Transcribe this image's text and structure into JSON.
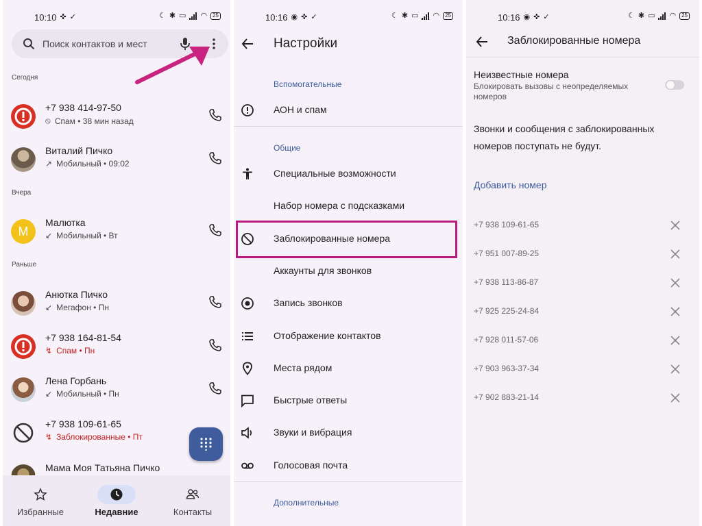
{
  "p1": {
    "time": "10:10",
    "battery": "25",
    "search_placeholder": "Поиск контактов и мест",
    "sections": {
      "today": "Сегодня",
      "yesterday": "Вчера",
      "earlier": "Раньше"
    },
    "calls": [
      {
        "name": "+7 938 414-97-50",
        "meta": "Спам • 38 мин назад",
        "type": "spam"
      },
      {
        "name": "Виталий Пичко",
        "meta": "Мобильный • 09:02",
        "type": "outgoing"
      },
      {
        "name": "Малютка",
        "meta": "Мобильный • Вт",
        "type": "incoming",
        "initial": "М"
      },
      {
        "name": "Анютка Пичко",
        "meta": "Мегафон • Пн",
        "type": "incoming"
      },
      {
        "name": "+7 938 164-81-54",
        "meta": "Спам • Пн",
        "type": "missed-spam"
      },
      {
        "name": "Лена Горбань",
        "meta": "Мобильный • Пн",
        "type": "incoming"
      },
      {
        "name": "+7 938 109-61-65",
        "meta": "Заблокированные • Пт",
        "type": "blocked"
      },
      {
        "name": "Мама Моя Татьяна Пичко",
        "meta": "",
        "type": "incoming"
      }
    ],
    "tabs": {
      "favorites": "Избранные",
      "recent": "Недавние",
      "contacts": "Контакты"
    },
    "colors": {
      "accent": "#3f5c9d",
      "spam_red": "#d93025",
      "arrow": "#c8237e"
    }
  },
  "p2": {
    "time": "10:16",
    "battery": "25",
    "title": "Настройки",
    "cat_aux": "Вспомогательные",
    "cat_general": "Общие",
    "cat_additional": "Дополнительные",
    "items": {
      "caller_id": "АОН и спам",
      "accessibility": "Специальные возможности",
      "assisted_dialing": "Набор номера с подсказками",
      "blocked": "Заблокированные номера",
      "calling_accounts": "Аккаунты для звонков",
      "call_recording": "Запись звонков",
      "display_options": "Отображение контактов",
      "nearby_places": "Места рядом",
      "quick_responses": "Быстрые ответы",
      "sounds": "Звуки и вибрация",
      "voicemail": "Голосовая почта"
    },
    "colors": {
      "highlight": "#b71c7e"
    }
  },
  "p3": {
    "time": "10:16",
    "battery": "25",
    "title": "Заблокированные номера",
    "unknown_title": "Неизвестные номера",
    "unknown_sub": "Блокировать вызовы с неопределяемых номеров",
    "unknown_enabled": false,
    "info": "Звонки и сообщения с заблокированных номеров поступать не будут.",
    "add": "Добавить номер",
    "numbers": [
      "+7 938 109-61-65",
      "+7 951 007-89-25",
      "+7 938 113-86-87",
      "+7 925 225-24-84",
      "+7 928 011-57-06",
      "+7 903 963-37-34",
      "+7 902 883-21-14"
    ]
  }
}
